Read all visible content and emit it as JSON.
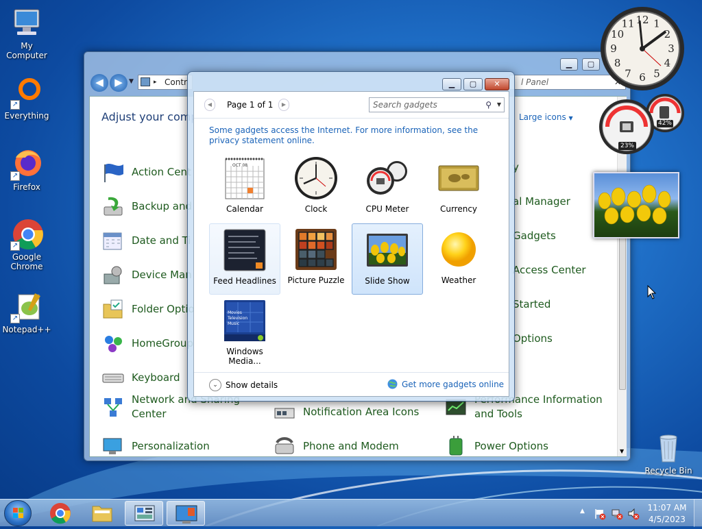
{
  "desktop": {
    "icons": [
      {
        "label": "My Computer"
      },
      {
        "label": "Everything"
      },
      {
        "label": "Firefox"
      },
      {
        "label": "Google Chrome"
      },
      {
        "label": "Notepad++"
      },
      {
        "label": "Recycle Bin"
      }
    ]
  },
  "control_panel": {
    "address": "Contr",
    "search_placeholder": "Search Control Panel",
    "search_visible": "l Panel",
    "heading": "Adjust your compu",
    "view_by": "Large icons",
    "items_left": [
      {
        "label": "Action Cent"
      },
      {
        "label": "Backup and"
      },
      {
        "label": "Date and Ti"
      },
      {
        "label": "Device Man"
      },
      {
        "label": "Folder Optio"
      },
      {
        "label": "HomeGroup"
      },
      {
        "label": "Keyboard"
      },
      {
        "label": "Network and Sharing Center"
      },
      {
        "label": "Personalization"
      }
    ],
    "items_mid": [
      {
        "label": "Notification Area Icons"
      },
      {
        "label": "Phone and Modem"
      }
    ],
    "items_right": [
      {
        "label": "y"
      },
      {
        "label": "al Manager"
      },
      {
        "label": "Gadgets"
      },
      {
        "label": "Access Center"
      },
      {
        "label": "Started"
      },
      {
        "label": "Options"
      },
      {
        "label": "Performance Information and Tools"
      },
      {
        "label": "Power Options"
      }
    ]
  },
  "gadget_gallery": {
    "page_label": "Page 1 of 1",
    "search_placeholder": "Search gadgets",
    "info_text": "Some gadgets access the Internet.  For more information, see the privacy statement online.",
    "gadgets": [
      {
        "label": "Calendar"
      },
      {
        "label": "Clock"
      },
      {
        "label": "CPU Meter"
      },
      {
        "label": "Currency"
      },
      {
        "label": "Feed Headlines"
      },
      {
        "label": "Picture Puzzle"
      },
      {
        "label": "Slide Show"
      },
      {
        "label": "Weather"
      },
      {
        "label": "Windows Media..."
      }
    ],
    "calendar_month": "OCT 08",
    "show_details": "Show details",
    "get_more": "Get more gadgets online"
  },
  "desktop_gadgets": {
    "cpu_percent": "23%",
    "memory_percent": "42%",
    "clock_numbers": [
      "12",
      "1",
      "2",
      "3",
      "4",
      "5",
      "6",
      "7",
      "8",
      "9",
      "10",
      "11"
    ]
  },
  "taskbar": {
    "time": "11:07 AM",
    "date": "4/5/2023"
  },
  "colors": {
    "link": "#1a63b8",
    "cp_item_text": "#1e5a1e",
    "selection_border": "#84acdd"
  }
}
